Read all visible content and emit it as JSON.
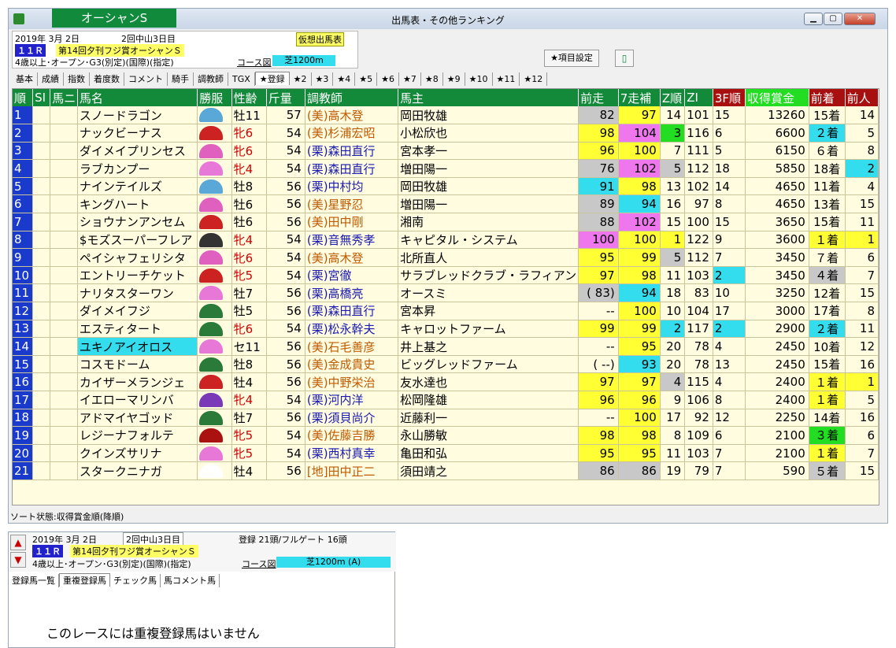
{
  "window": {
    "race_tab": "オーシャンS",
    "title": "出馬表・その他ランキング"
  },
  "info": {
    "date": "2019年  3月  2日",
    "meeting": "2回中山3日目",
    "yoso_badge": "仮想出馬表",
    "race_no": "１１Ｒ",
    "race_name": "第14回夕刊フジ賞オーシャンＳ",
    "conditions": "4歳以上･オープン･G3(別定)(国際)(指定)",
    "course_label": "コース図",
    "course_value": "芝1200m"
  },
  "toolbar": {
    "item_settings": "★項目設定",
    "horse_icon": "▯"
  },
  "tabs": [
    "基本",
    "成績",
    "指数",
    "着度数",
    "コメント",
    "騎手",
    "調教師",
    "TGX",
    "★登録",
    "★2",
    "★3",
    "★4",
    "★5",
    "★6",
    "★7",
    "★8",
    "★9",
    "★10",
    "★11",
    "★12"
  ],
  "columns": [
    "順",
    "SI",
    "馬ニ",
    "馬名",
    "勝服",
    "性齢",
    "斤量",
    "調教師",
    "馬主",
    "前走",
    "7走補",
    "Z順",
    "ZI",
    "3F順",
    "収得賞金",
    "前着",
    "前人"
  ],
  "silk_colors": [
    "#5aa8d8",
    "#cc2222",
    "#e060c0",
    "#e878d8",
    "#5aa8d8",
    "#e060c0",
    "#cc2222",
    "#333333",
    "#e060c0",
    "#cc2222",
    "#e878d8",
    "#2a7a3a",
    "#2a7a3a",
    "#e878d8",
    "#2a7a3a",
    "#cc2222",
    "#7a3ab8",
    "#2a7a3a",
    "#aa1111",
    "#e878d8",
    "#ffffff"
  ],
  "rows": [
    {
      "no": "1",
      "name": "スノードラゴン",
      "sex": "牡11",
      "f": false,
      "kin": "57",
      "trainer": "(美)高木登",
      "ritto": false,
      "owner": "岡田牧雄",
      "prev": "82",
      "prevc": "g",
      "s7": "97",
      "s7c": "y",
      "z": "14",
      "zc": "",
      "zi": "101",
      "f3": "15",
      "f3c": "",
      "prize": "13260",
      "place": "15着",
      "placec": "",
      "pop": "14",
      "popc": ""
    },
    {
      "no": "2",
      "name": "ナックビーナス",
      "sex": "牝6",
      "f": true,
      "kin": "54",
      "trainer": "(美)杉浦宏昭",
      "ritto": false,
      "owner": "小松欣也",
      "prev": "98",
      "prevc": "y",
      "s7": "104",
      "s7c": "m",
      "z": "3",
      "zc": "lg",
      "zi": "116",
      "f3": "6",
      "f3c": "",
      "prize": "6600",
      "place": "２着",
      "placec": "c",
      "pop": "5",
      "popc": ""
    },
    {
      "no": "3",
      "name": "ダイメイプリンセス",
      "sex": "牝6",
      "f": true,
      "kin": "54",
      "trainer": "(栗)森田直行",
      "ritto": true,
      "owner": "宮本孝一",
      "prev": "96",
      "prevc": "y",
      "s7": "100",
      "s7c": "y",
      "z": "7",
      "zc": "",
      "zi": "111",
      "f3": "5",
      "f3c": "",
      "prize": "6150",
      "place": "６着",
      "placec": "",
      "pop": "8",
      "popc": ""
    },
    {
      "no": "4",
      "name": "ラブカンプー",
      "sex": "牝4",
      "f": true,
      "kin": "54",
      "trainer": "(栗)森田直行",
      "ritto": true,
      "owner": "増田陽一",
      "prev": "76",
      "prevc": "g",
      "s7": "102",
      "s7c": "m",
      "z": "5",
      "zc": "g",
      "zi": "112",
      "f3": "18",
      "f3c": "",
      "prize": "5850",
      "place": "18着",
      "placec": "",
      "pop": "2",
      "popc": "c"
    },
    {
      "no": "5",
      "name": "ナインテイルズ",
      "sex": "牡8",
      "f": false,
      "kin": "56",
      "trainer": "(栗)中村均",
      "ritto": true,
      "owner": "岡田牧雄",
      "prev": "91",
      "prevc": "c",
      "s7": "98",
      "s7c": "y",
      "z": "13",
      "zc": "",
      "zi": "102",
      "f3": "14",
      "f3c": "",
      "prize": "4650",
      "place": "11着",
      "placec": "",
      "pop": "4",
      "popc": ""
    },
    {
      "no": "6",
      "name": "キングハート",
      "sex": "牡6",
      "f": false,
      "kin": "56",
      "trainer": "(美)星野忍",
      "ritto": false,
      "owner": "増田陽一",
      "prev": "89",
      "prevc": "g",
      "s7": "94",
      "s7c": "c",
      "z": "16",
      "zc": "",
      "zi": "97",
      "f3": "8",
      "f3c": "",
      "prize": "4650",
      "place": "13着",
      "placec": "",
      "pop": "15",
      "popc": ""
    },
    {
      "no": "7",
      "name": "ショウナンアンセム",
      "sex": "牡6",
      "f": false,
      "kin": "56",
      "trainer": "(美)田中剛",
      "ritto": false,
      "owner": "湘南",
      "prev": "88",
      "prevc": "g",
      "s7": "102",
      "s7c": "m",
      "z": "15",
      "zc": "",
      "zi": "100",
      "f3": "15",
      "f3c": "",
      "prize": "3650",
      "place": "15着",
      "placec": "",
      "pop": "11",
      "popc": ""
    },
    {
      "no": "8",
      "name": "$モズスーパーフレア",
      "sex": "牝4",
      "f": true,
      "kin": "54",
      "trainer": "(栗)音無秀孝",
      "ritto": true,
      "owner": "キャピタル・システム",
      "prev": "100",
      "prevc": "m",
      "s7": "100",
      "s7c": "y",
      "z": "1",
      "zc": "y",
      "zi": "122",
      "f3": "9",
      "f3c": "",
      "prize": "3600",
      "place": "１着",
      "placec": "y",
      "pop": "1",
      "popc": "y"
    },
    {
      "no": "9",
      "name": "ペイシャフェリシタ",
      "sex": "牝6",
      "f": true,
      "kin": "54",
      "trainer": "(美)高木登",
      "ritto": false,
      "owner": "北所直人",
      "prev": "95",
      "prevc": "y",
      "s7": "99",
      "s7c": "y",
      "z": "5",
      "zc": "g",
      "zi": "112",
      "f3": "7",
      "f3c": "",
      "prize": "3450",
      "place": "７着",
      "placec": "",
      "pop": "6",
      "popc": ""
    },
    {
      "no": "10",
      "name": "エントリーチケット",
      "sex": "牝5",
      "f": true,
      "kin": "54",
      "trainer": "(栗)宮徹",
      "ritto": true,
      "owner": "サラブレッドクラブ・ラフィアン",
      "prev": "97",
      "prevc": "y",
      "s7": "98",
      "s7c": "y",
      "z": "11",
      "zc": "",
      "zi": "103",
      "f3": "2",
      "f3c": "c",
      "prize": "3450",
      "place": "４着",
      "placec": "g",
      "pop": "7",
      "popc": ""
    },
    {
      "no": "11",
      "name": "ナリタスターワン",
      "sex": "牡7",
      "f": false,
      "kin": "56",
      "trainer": "(栗)高橋亮",
      "ritto": true,
      "owner": "オースミ",
      "prev": "( 83)",
      "prevc": "g",
      "s7": "94",
      "s7c": "c",
      "z": "18",
      "zc": "",
      "zi": "83",
      "f3": "10",
      "f3c": "",
      "prize": "3250",
      "place": "12着",
      "placec": "",
      "pop": "15",
      "popc": ""
    },
    {
      "no": "12",
      "name": "ダイメイフジ",
      "sex": "牡5",
      "f": false,
      "kin": "56",
      "trainer": "(栗)森田直行",
      "ritto": true,
      "owner": "宮本昇",
      "prev": "--",
      "prevc": "",
      "s7": "100",
      "s7c": "y",
      "z": "10",
      "zc": "",
      "zi": "104",
      "f3": "17",
      "f3c": "",
      "prize": "3000",
      "place": "17着",
      "placec": "",
      "pop": "8",
      "popc": ""
    },
    {
      "no": "13",
      "name": "エスティタート",
      "sex": "牝6",
      "f": true,
      "kin": "54",
      "trainer": "(栗)松永幹夫",
      "ritto": true,
      "owner": "キャロットファーム",
      "prev": "99",
      "prevc": "y",
      "s7": "99",
      "s7c": "y",
      "z": "2",
      "zc": "c",
      "zi": "117",
      "f3": "2",
      "f3c": "c",
      "prize": "2900",
      "place": "２着",
      "placec": "c",
      "pop": "11",
      "popc": ""
    },
    {
      "no": "14",
      "name": "ユキノアイオロス",
      "sex": "セ11",
      "f": false,
      "kin": "56",
      "trainer": "(美)石毛善彦",
      "ritto": false,
      "owner": "井上基之",
      "prev": "--",
      "prevc": "",
      "s7": "95",
      "s7c": "y",
      "z": "20",
      "zc": "",
      "zi": "78",
      "f3": "4",
      "f3c": "",
      "prize": "2450",
      "place": "10着",
      "placec": "",
      "pop": "12",
      "popc": ""
    },
    {
      "no": "15",
      "name": "コスモドーム",
      "sex": "牡8",
      "f": false,
      "kin": "56",
      "trainer": "(美)金成貴史",
      "ritto": false,
      "owner": "ビッグレッドファーム",
      "prev": "( --)",
      "prevc": "",
      "s7": "93",
      "s7c": "c",
      "z": "20",
      "zc": "",
      "zi": "78",
      "f3": "13",
      "f3c": "",
      "prize": "2450",
      "place": "15着",
      "placec": "",
      "pop": "16",
      "popc": ""
    },
    {
      "no": "16",
      "name": "カイザーメランジェ",
      "sex": "牡4",
      "f": false,
      "kin": "56",
      "trainer": "(美)中野栄治",
      "ritto": false,
      "owner": "友水達也",
      "prev": "97",
      "prevc": "y",
      "s7": "97",
      "s7c": "y",
      "z": "4",
      "zc": "g",
      "zi": "115",
      "f3": "4",
      "f3c": "",
      "prize": "2400",
      "place": "１着",
      "placec": "y",
      "pop": "1",
      "popc": "y"
    },
    {
      "no": "17",
      "name": "イエローマリンバ",
      "sex": "牝4",
      "f": true,
      "kin": "54",
      "trainer": "(栗)河内洋",
      "ritto": true,
      "owner": "松岡隆雄",
      "prev": "96",
      "prevc": "y",
      "s7": "96",
      "s7c": "y",
      "z": "9",
      "zc": "",
      "zi": "106",
      "f3": "8",
      "f3c": "",
      "prize": "2400",
      "place": "１着",
      "placec": "y",
      "pop": "5",
      "popc": ""
    },
    {
      "no": "18",
      "name": "アドマイヤゴッド",
      "sex": "牡7",
      "f": false,
      "kin": "56",
      "trainer": "(栗)須貝尚介",
      "ritto": true,
      "owner": "近藤利一",
      "prev": "--",
      "prevc": "",
      "s7": "100",
      "s7c": "y",
      "z": "17",
      "zc": "",
      "zi": "92",
      "f3": "12",
      "f3c": "",
      "prize": "2250",
      "place": "14着",
      "placec": "",
      "pop": "16",
      "popc": ""
    },
    {
      "no": "19",
      "name": "レジーナフォルテ",
      "sex": "牝5",
      "f": true,
      "kin": "54",
      "trainer": "(美)佐藤吉勝",
      "ritto": false,
      "owner": "永山勝敏",
      "prev": "98",
      "prevc": "y",
      "s7": "98",
      "s7c": "y",
      "z": "8",
      "zc": "",
      "zi": "109",
      "f3": "6",
      "f3c": "",
      "prize": "2100",
      "place": "３着",
      "placec": "lg",
      "pop": "6",
      "popc": ""
    },
    {
      "no": "20",
      "name": "クインズサリナ",
      "sex": "牝5",
      "f": true,
      "kin": "54",
      "trainer": "(栗)西村真幸",
      "ritto": true,
      "owner": "亀田和弘",
      "prev": "95",
      "prevc": "y",
      "s7": "95",
      "s7c": "y",
      "z": "11",
      "zc": "",
      "zi": "103",
      "f3": "7",
      "f3c": "",
      "prize": "2100",
      "place": "１着",
      "placec": "y",
      "pop": "7",
      "popc": ""
    },
    {
      "no": "21",
      "name": "スタークニナガ",
      "sex": "牡4",
      "f": false,
      "kin": "56",
      "trainer": "[地]田中正二",
      "ritto": false,
      "owner": "須田靖之",
      "prev": "86",
      "prevc": "g",
      "s7": "86",
      "s7c": "g",
      "z": "19",
      "zc": "",
      "zi": "79",
      "f3": "7",
      "f3c": "",
      "prize": "590",
      "place": "５着",
      "placec": "g",
      "pop": "15",
      "popc": ""
    }
  ],
  "sort_status": "ソート状態:収得賞金順(降順)",
  "sub": {
    "date": "2019年  3月  2日",
    "meeting": "2回中山3日目",
    "entries": "登録 21頭/フルゲート 16頭",
    "race_no": "１１Ｒ",
    "race_name": "第14回夕刊フジ賞オーシャンＳ",
    "conditions": "4歳以上･オープン･G3(別定)(国際)(指定)",
    "course_label": "コース図",
    "course_value": "芝1200m (A)",
    "tabs": [
      "登録馬一覧",
      "重複登録馬",
      "チェック馬",
      "馬コメント馬"
    ],
    "message": "このレースには重複登録馬はいません"
  }
}
